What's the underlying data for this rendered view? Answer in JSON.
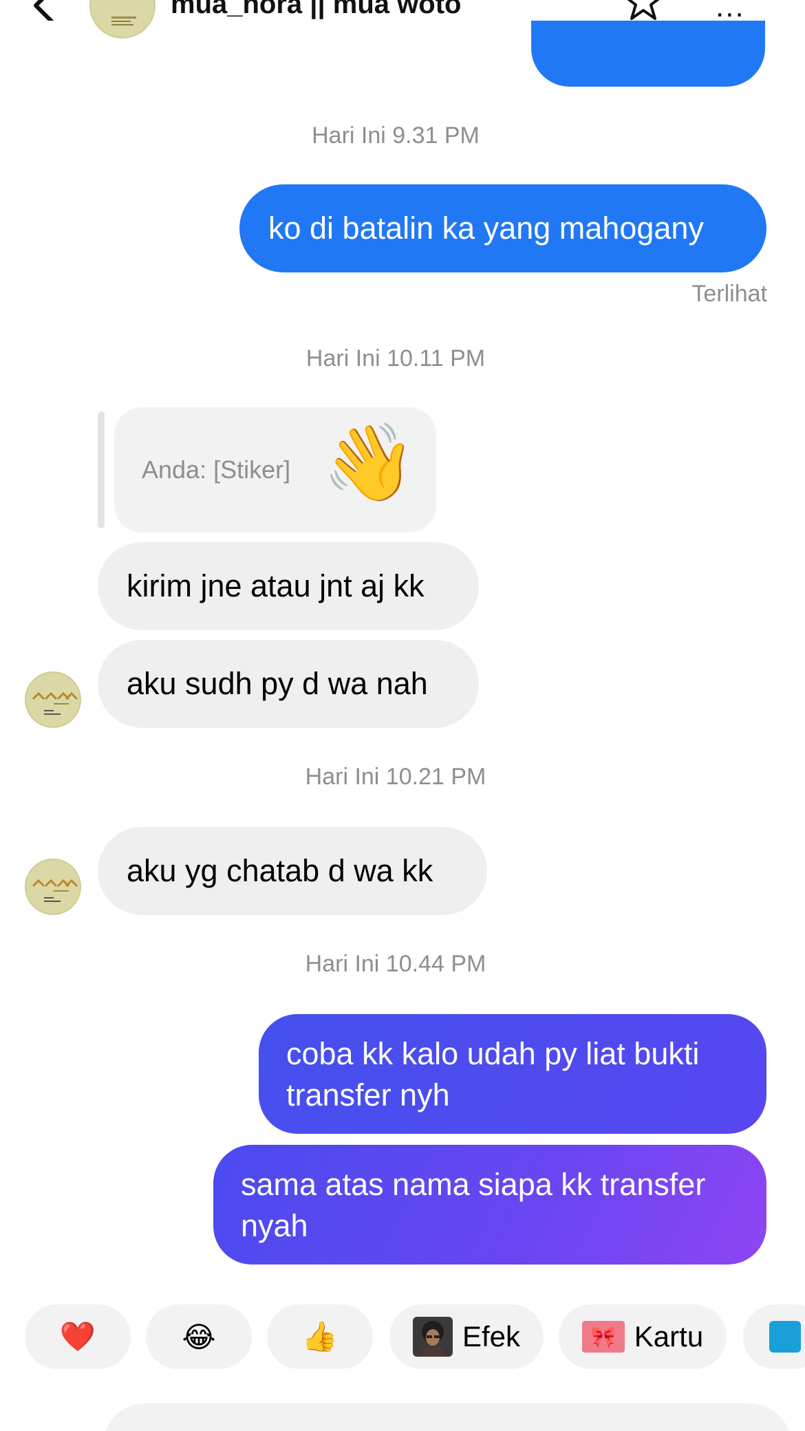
{
  "header": {
    "name": "mua_nora || mua woto",
    "more_label": "..."
  },
  "messages": [
    {
      "timestamp": "Hari Ini 9.31 PM"
    },
    {
      "text": "ko di batalin ka yang mahogany",
      "status": "Terlihat"
    },
    {
      "timestamp": "Hari Ini 10.11 PM"
    },
    {
      "reply_preview": "Anda: [Stiker]",
      "reply_sticker": "👋"
    },
    {
      "text": "kirim jne atau jnt aj kk"
    },
    {
      "text": "aku sudh py d wa nah"
    },
    {
      "timestamp": "Hari Ini 10.21 PM"
    },
    {
      "text": "aku yg chatab d wa kk"
    },
    {
      "timestamp": "Hari Ini 10.44 PM"
    },
    {
      "text_line1": "coba kk kalo udah py liat bukti",
      "text_line2": "transfer nyh"
    },
    {
      "text_line1": "sama atas nama siapa kk transfer",
      "text_line2": "nyah"
    }
  ],
  "quick_bar": {
    "heart": "❤️",
    "laugh": "😂",
    "thumbs": "👍",
    "effects_label": "Efek",
    "cards_label": "Kartu"
  },
  "colors": {
    "outgoing_blue": "#2178f4",
    "outgoing_indigo": "#4b49ef",
    "outgoing_purple": "#8e45f3",
    "incoming_gray": "#efefef",
    "meta_gray": "#8e8e8e"
  }
}
